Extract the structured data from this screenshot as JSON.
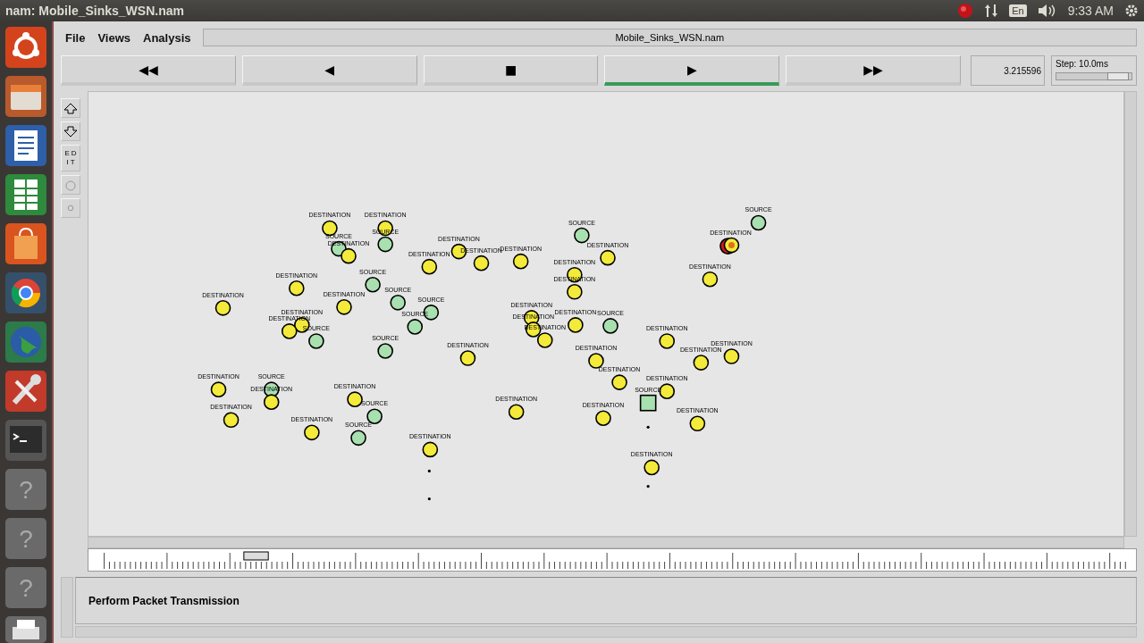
{
  "top_panel": {
    "title": "nam: Mobile_Sinks_WSN.nam",
    "keyboard": "En",
    "clock": "9:33 AM"
  },
  "launcher_help": [
    "?",
    "?",
    "?"
  ],
  "menu": [
    {
      "label": "File"
    },
    {
      "label": "Views"
    },
    {
      "label": "Analysis"
    }
  ],
  "file_name": "Mobile_Sinks_WSN.nam",
  "transport": [
    {
      "label": "◀◀",
      "selected": false
    },
    {
      "label": "◀",
      "selected": false
    },
    {
      "label": "■",
      "selected": false
    },
    {
      "label": "▶",
      "selected": true
    },
    {
      "label": "▶▶",
      "selected": false
    }
  ],
  "sim_time": "3.215596",
  "step": {
    "label": "Step: 10.0ms",
    "level": 0.82
  },
  "tools": [
    {
      "kind": "icon"
    },
    {
      "kind": "icon"
    },
    {
      "kind": "text",
      "label": "EDIT"
    },
    {
      "kind": "icon"
    },
    {
      "kind": "icon"
    }
  ],
  "nodes": [
    {
      "label": "DESTINATION",
      "kind": "destination",
      "active": false
    },
    {
      "label": "DESTINATION",
      "kind": "destination",
      "active": false
    },
    {
      "label": "SOURCE",
      "kind": "source",
      "active": false
    },
    {
      "label": "SOURCE",
      "kind": "source",
      "active": false
    },
    {
      "label": "DESTINATION",
      "kind": "destination",
      "active": false
    },
    {
      "label": "DESTINATION",
      "kind": "destination",
      "active": false
    },
    {
      "label": "DESTINATION",
      "kind": "destination",
      "active": false
    },
    {
      "label": "DESTINATION",
      "kind": "destination",
      "active": false
    },
    {
      "label": "DESTINATION",
      "kind": "destination",
      "active": false
    },
    {
      "label": "SOURCE",
      "kind": "source",
      "active": false
    },
    {
      "label": "DESTINATION",
      "kind": "destination",
      "active": false
    },
    {
      "label": "DESTINATION",
      "kind": "destination",
      "active": false
    },
    {
      "label": "DESTINATION",
      "kind": "destination",
      "active": false
    },
    {
      "label": "SOURCE",
      "kind": "source",
      "active": false
    },
    {
      "label": "DESTINATION",
      "kind": "destination",
      "active": true
    },
    {
      "label": "DESTINATION",
      "kind": "destination",
      "active": false
    },
    {
      "label": "DESTINATION",
      "kind": "destination",
      "active": false
    },
    {
      "label": "SOURCE",
      "kind": "source",
      "active": false
    },
    {
      "label": "DESTINATION",
      "kind": "destination",
      "active": false
    },
    {
      "label": "DESTINATION",
      "kind": "destination",
      "active": false
    },
    {
      "label": "SOURCE",
      "kind": "source",
      "active": false
    },
    {
      "label": "SOURCE",
      "kind": "source",
      "active": false
    },
    {
      "label": "SOURCE",
      "kind": "source",
      "active": false
    },
    {
      "label": "DESTINATION",
      "kind": "destination",
      "active": false
    },
    {
      "label": "DESTINATION",
      "kind": "destination",
      "active": false
    },
    {
      "label": "SOURCE",
      "kind": "source",
      "active": false
    },
    {
      "label": "SOURCE",
      "kind": "source",
      "active": false
    },
    {
      "label": "DESTINATION",
      "kind": "destination",
      "active": false
    },
    {
      "label": "DESTINATION",
      "kind": "destination",
      "active": false
    },
    {
      "label": "DESTINATION",
      "kind": "destination",
      "active": false
    },
    {
      "label": "DESTINATION",
      "kind": "destination",
      "active": false
    },
    {
      "label": "DESTINATION",
      "kind": "destination",
      "active": false
    },
    {
      "label": "SOURCE",
      "kind": "source",
      "active": false
    },
    {
      "label": "DESTINATION",
      "kind": "destination",
      "active": false
    },
    {
      "label": "DESTINATION",
      "kind": "destination",
      "active": false
    },
    {
      "label": "DESTINATION",
      "kind": "destination",
      "active": false
    },
    {
      "label": "DESTINATION",
      "kind": "destination",
      "active": false
    },
    {
      "label": "DESTINATION",
      "kind": "destination",
      "active": false
    },
    {
      "label": "DESTINATION",
      "kind": "destination",
      "active": false
    },
    {
      "label": "SOURCE",
      "kind": "sink",
      "active": false
    },
    {
      "label": "DESTINATION",
      "kind": "destination",
      "active": false
    },
    {
      "label": "SOURCE",
      "kind": "source",
      "active": false
    },
    {
      "label": "DESTINATION",
      "kind": "destination",
      "active": false
    },
    {
      "label": "DESTINATION",
      "kind": "destination",
      "active": false
    },
    {
      "label": "SOURCE",
      "kind": "source",
      "active": false
    },
    {
      "label": "DESTINATION",
      "kind": "destination",
      "active": false
    },
    {
      "label": "DESTINATION",
      "kind": "destination",
      "active": false
    },
    {
      "label": "SOURCE",
      "kind": "source",
      "active": false
    },
    {
      "label": "DESTINATION",
      "kind": "destination",
      "active": false
    },
    {
      "label": "DESTINATION",
      "kind": "destination",
      "active": false
    },
    {
      "label": "DESTINATION",
      "kind": "destination",
      "active": false
    },
    {
      "label": "DESTINATION",
      "kind": "destination",
      "active": false
    },
    {
      "label": "DESTINATION",
      "kind": "destination",
      "active": false
    }
  ],
  "timeline": {
    "level": 0.16
  },
  "annotation": "Perform Packet Transmission"
}
